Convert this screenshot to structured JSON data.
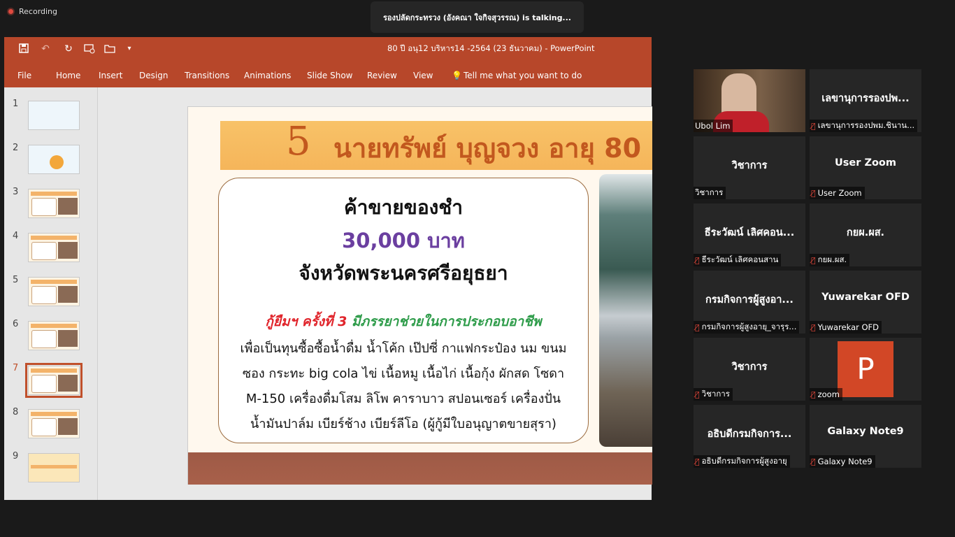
{
  "recording": {
    "label": "Recording"
  },
  "talking": {
    "text": "รองปลัดกระทรวง (อังคณา ใจกิจสุวรรณ) is  talking..."
  },
  "ppt": {
    "title": "80 ปี อนุ12 บริหาร14 -2564 (23 ธันวาคม)  -  PowerPoint",
    "tabs": [
      "File",
      "Home",
      "Insert",
      "Design",
      "Transitions",
      "Animations",
      "Slide Show",
      "Review",
      "View"
    ],
    "tell_me": "Tell me what you want to do",
    "accent": "#b7472a"
  },
  "thumbnails": [
    "1",
    "2",
    "3",
    "4",
    "5",
    "6",
    "7",
    "8",
    "9"
  ],
  "selected_slide": 7,
  "slide": {
    "number": "5",
    "name": "นายทรัพย์ บุญจวง อายุ 80",
    "line1": "ค้าขายของชำ",
    "line2": "30,000 บาท",
    "line3": "จังหวัดพระนครศรีอยุธยา",
    "loan_red": "กู้ยืมฯ ครั้งที่ 3",
    "loan_green": "มีภรรยาช่วยในการประกอบอาชีพ",
    "desc": [
      "เพื่อเป็นทุนซื้อซื้อน้ำดื่ม น้ำโค้ก เป๊ปซี่ กาแฟกระป๋อง นม ขนม",
      "ซอง กระทะ big cola ไข่ เนื้อหมู เนื้อไก่ เนื้อกุ้ง ผักสด โซดา",
      "M-150 เครื่องดื่มโสม ลิโพ คาราบาว สปอนเซอร์ เครื่องปั่น",
      "น้ำมันปาล์ม เบียร์ช้าง เบียร์ลีโอ (ผู้กู้มีใบอนุญาตขายสุรา)"
    ]
  },
  "participants": [
    {
      "name": "",
      "label": "Ubol Lim",
      "muted": false,
      "video": true
    },
    {
      "name": "เลขานุการรองปพ...",
      "label": "เลขานุการรองปพม.ชินาน...",
      "muted": true
    },
    {
      "name": "วิชาการ",
      "label": "วิชาการ",
      "muted": false
    },
    {
      "name": "User Zoom",
      "label": "User Zoom",
      "muted": true
    },
    {
      "name": "ธีระวัฒน์ เลิศคอน...",
      "label": "ธีระวัฒน์ เลิศคอนสาน",
      "muted": true
    },
    {
      "name": "กยผ.ผส.",
      "label": "กยผ.ผส.",
      "muted": true
    },
    {
      "name": "กรมกิจการผู้สูงอา...",
      "label": "กรมกิจการผู้สูงอายุ_จารุร...",
      "muted": true
    },
    {
      "name": "Yuwarekar OFD",
      "label": "Yuwarekar OFD",
      "muted": true
    },
    {
      "name": "วิชาการ",
      "label": "วิชาการ",
      "muted": true
    },
    {
      "name": "",
      "label": "zoom",
      "muted": true,
      "logo": "P"
    },
    {
      "name": "อธิบดีกรมกิจการ...",
      "label": "อธิบดีกรมกิจการผู้สูงอายุ",
      "muted": true
    },
    {
      "name": "Galaxy Note9",
      "label": "Galaxy Note9",
      "muted": true
    }
  ]
}
